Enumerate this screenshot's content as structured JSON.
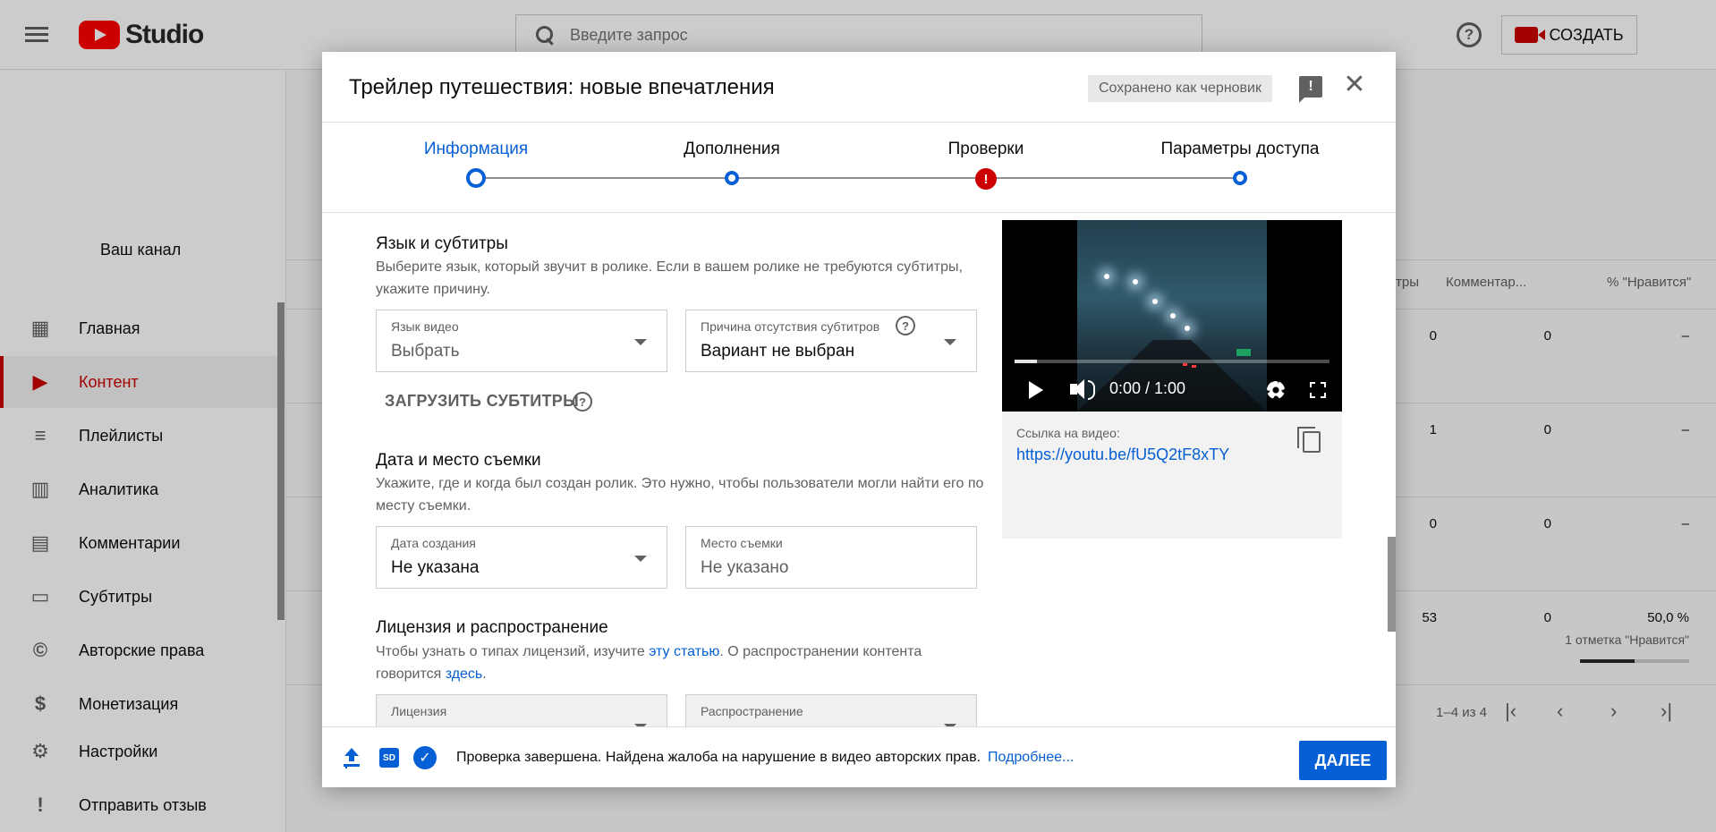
{
  "topbar": {
    "logo_text": "Studio",
    "search_placeholder": "Введите запрос",
    "help_glyph": "?",
    "create_label": "СОЗДАТЬ"
  },
  "sidebar": {
    "channel_label": "Ваш канал",
    "items": [
      {
        "label": "Главная",
        "icon": "dashboard-icon",
        "glyph": "▦"
      },
      {
        "label": "Контент",
        "icon": "content-icon",
        "glyph": "▶"
      },
      {
        "label": "Плейлисты",
        "icon": "playlist-icon",
        "glyph": "≡"
      },
      {
        "label": "Аналитика",
        "icon": "analytics-icon",
        "glyph": "▥"
      },
      {
        "label": "Комментарии",
        "icon": "comments-icon",
        "glyph": "▤"
      },
      {
        "label": "Субтитры",
        "icon": "subtitles-icon",
        "glyph": "▭"
      },
      {
        "label": "Авторские права",
        "icon": "copyright-icon",
        "glyph": "©"
      },
      {
        "label": "Монетизация",
        "icon": "dollar-icon",
        "glyph": "$"
      },
      {
        "label": "Настройки",
        "icon": "settings-icon",
        "glyph": "⚙"
      },
      {
        "label": "Отправить отзыв",
        "icon": "feedback-icon",
        "glyph": "!"
      }
    ]
  },
  "background_table": {
    "headers": [
      "тры",
      "Комментар...",
      "% \"Нравится\""
    ],
    "rows": [
      [
        "0",
        "0",
        "–"
      ],
      [
        "1",
        "0",
        "–"
      ],
      [
        "0",
        "0",
        "–"
      ],
      [
        "53",
        "0",
        "50,0 %"
      ]
    ],
    "like_count_label": "1 отметка \"Нравится\"",
    "like_ratio": 0.5,
    "pagination": "1–4 из 4"
  },
  "dialog": {
    "title": "Трейлер путешествия: новые впечатления",
    "draft_badge": "Сохранено как черновик",
    "feedback_glyph": "!",
    "close_glyph": "✕",
    "steps": [
      {
        "label": "Информация",
        "state": "active"
      },
      {
        "label": "Дополнения",
        "state": "normal"
      },
      {
        "label": "Проверки",
        "state": "error"
      },
      {
        "label": "Параметры доступа",
        "state": "normal"
      }
    ],
    "error_glyph": "!",
    "language_section": {
      "title": "Язык и субтитры",
      "description": "Выберите язык, который звучит в ролике. Если в вашем ролике не требуются субтитры, укажите причину.",
      "video_language_label": "Язык видео",
      "video_language_value": "Выбрать",
      "no_subs_reason_label": "Причина отсутствия субтитров",
      "no_subs_reason_value": "Вариант не выбран",
      "upload_subtitles_label": "ЗАГРУЗИТЬ СУБТИТРЫ"
    },
    "date_section": {
      "title": "Дата и место съемки",
      "description": "Укажите, где и когда был создан ролик. Это нужно, чтобы пользователи могли найти его по месту съемки.",
      "creation_date_label": "Дата создания",
      "creation_date_value": "Не указана",
      "location_label": "Место съемки",
      "location_placeholder": "Не указано"
    },
    "license_section": {
      "title": "Лицензия и распространение",
      "description_prefix": "Чтобы узнать о типах лицензий, изучите ",
      "description_link1": "эту статью",
      "description_middle": ". О распространении контента говорится ",
      "description_link2": "здесь",
      "description_suffix": ".",
      "license_label": "Лицензия",
      "distribution_label": "Распространение"
    },
    "preview": {
      "time": "0:00 / 1:00",
      "progress": 0.07,
      "link_label": "Ссылка на видео:",
      "link_url": "https://youtu.be/fU5Q2tF8xTY"
    },
    "footer": {
      "sd_badge": "SD",
      "check_glyph": "✓",
      "message": "Проверка завершена. Найдена жалоба на нарушение в видео авторских прав.",
      "link": "Подробнее...",
      "next_label": "ДАЛЕЕ"
    }
  },
  "colors": {
    "accent_blue": "#065fd4",
    "brand_red": "#ff0000",
    "error_red": "#cc0000"
  }
}
